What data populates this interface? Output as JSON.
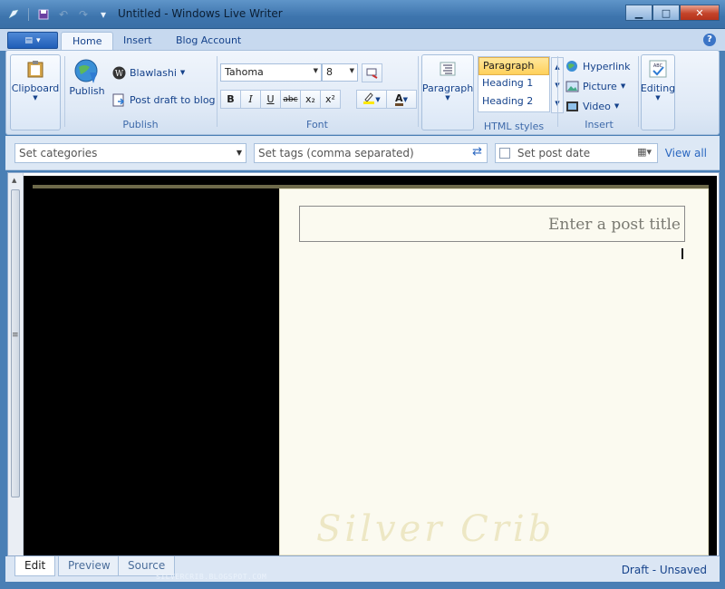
{
  "window": {
    "title": "Untitled - Windows Live Writer"
  },
  "tabs": [
    {
      "label": "Home"
    },
    {
      "label": "Insert"
    },
    {
      "label": "Blog Account"
    }
  ],
  "ribbon": {
    "clipboard": {
      "label": "Clipboard"
    },
    "publish": {
      "publish_label": "Publish",
      "blog_name": "Blawlashi",
      "post_draft_label": "Post draft to blog",
      "group_label": "Publish"
    },
    "font": {
      "family": "Tahoma",
      "size": "8",
      "group_label": "Font",
      "bold": "B",
      "italic": "I",
      "underline": "U",
      "strike": "abc",
      "subscript": "x₂",
      "superscript": "x²",
      "font_color": "A"
    },
    "paragraph": {
      "label": "Paragraph"
    },
    "html_styles": {
      "items": [
        "Paragraph",
        "Heading 1",
        "Heading 2"
      ],
      "selected": "Paragraph",
      "group_label": "HTML styles"
    },
    "insert": {
      "hyperlink": "Hyperlink",
      "picture": "Picture",
      "video": "Video",
      "group_label": "Insert"
    },
    "editing": {
      "label": "Editing"
    }
  },
  "properties": {
    "categories_placeholder": "Set categories",
    "tags_placeholder": "Set tags (comma separated)",
    "post_date_label": "Set post date",
    "view_all": "View all"
  },
  "editor": {
    "title_placeholder": "Enter a post title",
    "watermark_text": "Silver Crib"
  },
  "view_tabs": [
    {
      "label": "Edit"
    },
    {
      "label": "Preview"
    },
    {
      "label": "Source"
    }
  ],
  "status": "Draft - Unsaved",
  "credit": "SILVERCRIB.BLOGSPOT.COM",
  "colors": {
    "accent": "#15428b",
    "titlebar": "#3d74ad",
    "selected_style": "#ffd05a"
  }
}
